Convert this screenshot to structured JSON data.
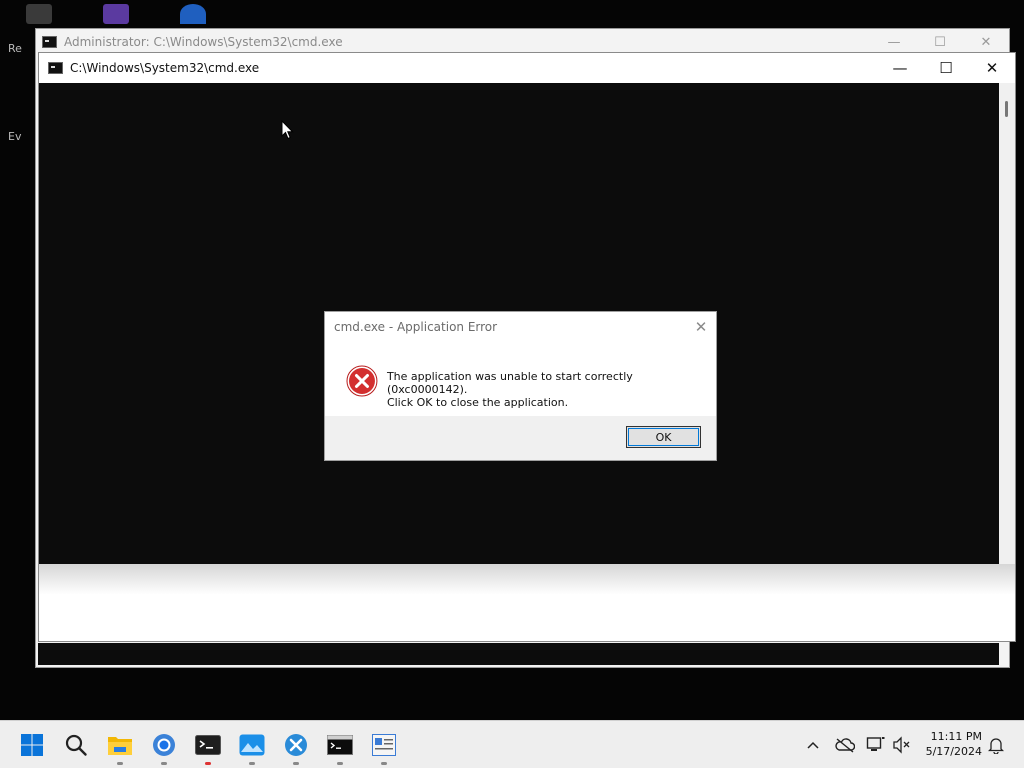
{
  "desktop": {
    "partial_labels": [
      "Re",
      "Ev"
    ]
  },
  "back_window": {
    "title": "Administrator: C:\\Windows\\System32\\cmd.exe",
    "minimize": "—",
    "maximize": "☐",
    "close": "✕"
  },
  "front_window": {
    "title": "C:\\Windows\\System32\\cmd.exe",
    "minimize": "—",
    "maximize": "☐",
    "close": "✕"
  },
  "dialog": {
    "title": "cmd.exe - Application Error",
    "close": "✕",
    "message_line1": "The application was unable to start correctly (0xc0000142).",
    "message_line2": "Click OK to close the application.",
    "ok_label": "OK"
  },
  "taskbar": {
    "icons": [
      "windows-start-icon",
      "search-icon",
      "file-explorer-icon",
      "chrome-icon",
      "terminal-icon",
      "photos-icon",
      "vscode-icon",
      "cmd-icon",
      "notepad-icon"
    ],
    "tray": {
      "chevron": "^",
      "time": "11:11 PM",
      "date": "5/17/2024"
    }
  },
  "colors": {
    "console_bg": "#0c0c0c",
    "error_red": "#d32f2f",
    "accent": "#0078d7",
    "taskbar_bg": "#eeeeee"
  }
}
